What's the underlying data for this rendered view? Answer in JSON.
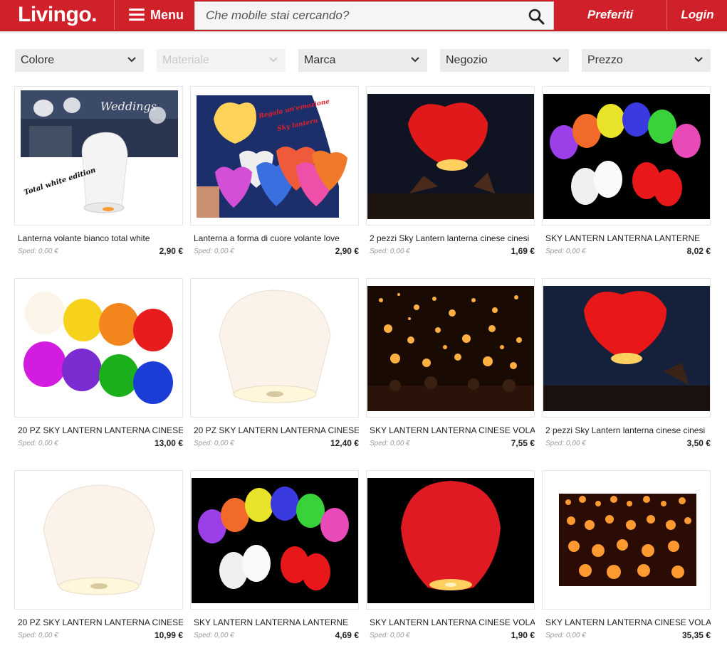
{
  "header": {
    "logo": "Livingo.",
    "menu_label": "Menu",
    "search_placeholder": "Che mobile stai cercando?",
    "favorites_label": "Preferiti",
    "login_label": "Login"
  },
  "colors": {
    "brand": "#d0202a",
    "filter_bg": "#ebebeb",
    "muted": "#999999"
  },
  "filters": [
    {
      "label": "Colore",
      "enabled": true
    },
    {
      "label": "Materiale",
      "enabled": false
    },
    {
      "label": "Marca",
      "enabled": true
    },
    {
      "label": "Negozio",
      "enabled": true
    },
    {
      "label": "Prezzo",
      "enabled": true
    }
  ],
  "products": [
    {
      "title": "Lanterna volante bianco total white",
      "shipping": "Sped: 0,00 €",
      "price": "2,90 €",
      "image_overlay": [
        "Weddings",
        "Total white edition"
      ]
    },
    {
      "title": "Lanterna a forma di cuore volante love",
      "shipping": "Sped: 0,00 €",
      "price": "2,90 €",
      "image_overlay": [
        "Regala un'emozione",
        "Sky lantern"
      ]
    },
    {
      "title": "2 pezzi Sky Lantern lanterna cinese cinesi",
      "shipping": "Sped: 0,00 €",
      "price": "1,69 €"
    },
    {
      "title": "SKY LANTERN LANTERNA LANTERNE",
      "shipping": "Sped: 0,00 €",
      "price": "8,02 €"
    },
    {
      "title": "20 PZ SKY LANTERN LANTERNA CINESE",
      "shipping": "Sped: 0,00 €",
      "price": "13,00 €"
    },
    {
      "title": "20 PZ SKY LANTERN LANTERNA CINESE",
      "shipping": "Sped: 0,00 €",
      "price": "12,40 €"
    },
    {
      "title": "SKY LANTERN LANTERNA CINESE VOLANTE",
      "shipping": "Sped: 0,00 €",
      "price": "7,55 €"
    },
    {
      "title": "2 pezzi Sky Lantern lanterna cinese cinesi",
      "shipping": "Sped: 0,00 €",
      "price": "3,50 €"
    },
    {
      "title": "20 PZ SKY LANTERN LANTERNA CINESE",
      "shipping": "Sped: 0,00 €",
      "price": "10,99 €"
    },
    {
      "title": "SKY LANTERN LANTERNA LANTERNE",
      "shipping": "Sped: 0,00 €",
      "price": "4,69 €"
    },
    {
      "title": "SKY LANTERN LANTERNA CINESE VOLANTE",
      "shipping": "Sped: 0,00 €",
      "price": "1,90 €"
    },
    {
      "title": "SKY LANTERN LANTERNA CINESE VOLANTE",
      "shipping": "Sped: 0,00 €",
      "price": "35,35 €"
    }
  ]
}
